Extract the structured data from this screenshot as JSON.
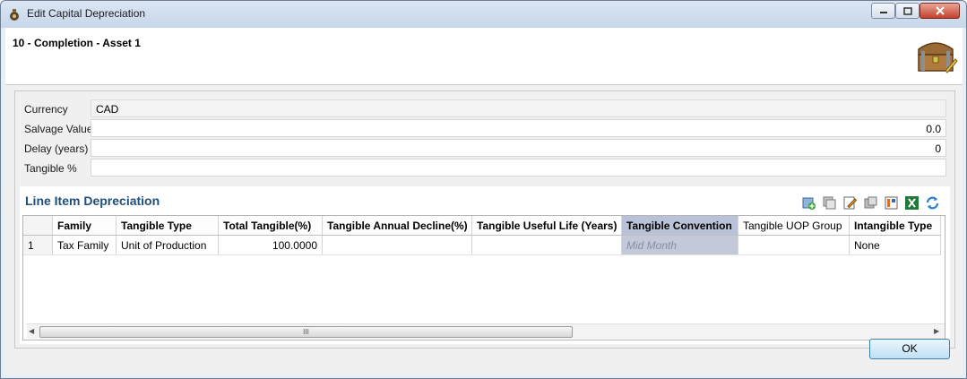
{
  "window": {
    "title": "Edit Capital Depreciation",
    "icons": {
      "app": "money-bag-icon",
      "minimize": "minimize-icon",
      "maximize": "maximize-icon",
      "close": "close-icon"
    }
  },
  "header": {
    "title": "10 - Completion - Asset 1",
    "logo": "treasure-chest-icon"
  },
  "form": {
    "currency": {
      "label": "Currency",
      "value": "CAD"
    },
    "salvage": {
      "label": "Salvage Value",
      "value": "0.0"
    },
    "delay": {
      "label": "Delay (years)",
      "value": "0"
    },
    "tangible_pct": {
      "label": "Tangible %",
      "value": ""
    }
  },
  "section": {
    "title": "Line Item Depreciation",
    "toolbar_icons": [
      "add-row-icon",
      "copy-rows-icon",
      "edit-icon",
      "paste-rows-icon",
      "filter-columns-icon",
      "export-excel-icon",
      "refresh-icon"
    ]
  },
  "grid": {
    "columns": [
      "",
      "Family",
      "Tangible Type",
      "Total Tangible(%)",
      "Tangible Annual Decline(%)",
      "Tangible Useful Life (Years)",
      "Tangible Convention",
      "Tangible UOP Group",
      "Intangible Type"
    ],
    "rows": [
      [
        "1",
        "Tax Family",
        "Unit of Production",
        "100.0000",
        "",
        "",
        "Mid Month",
        "",
        "None"
      ]
    ],
    "scroll_thumb_text": "III"
  },
  "footer": {
    "ok_label": "OK"
  },
  "colors": {
    "accent": "#1f4e79",
    "selected_column": "#b9c2d6"
  }
}
